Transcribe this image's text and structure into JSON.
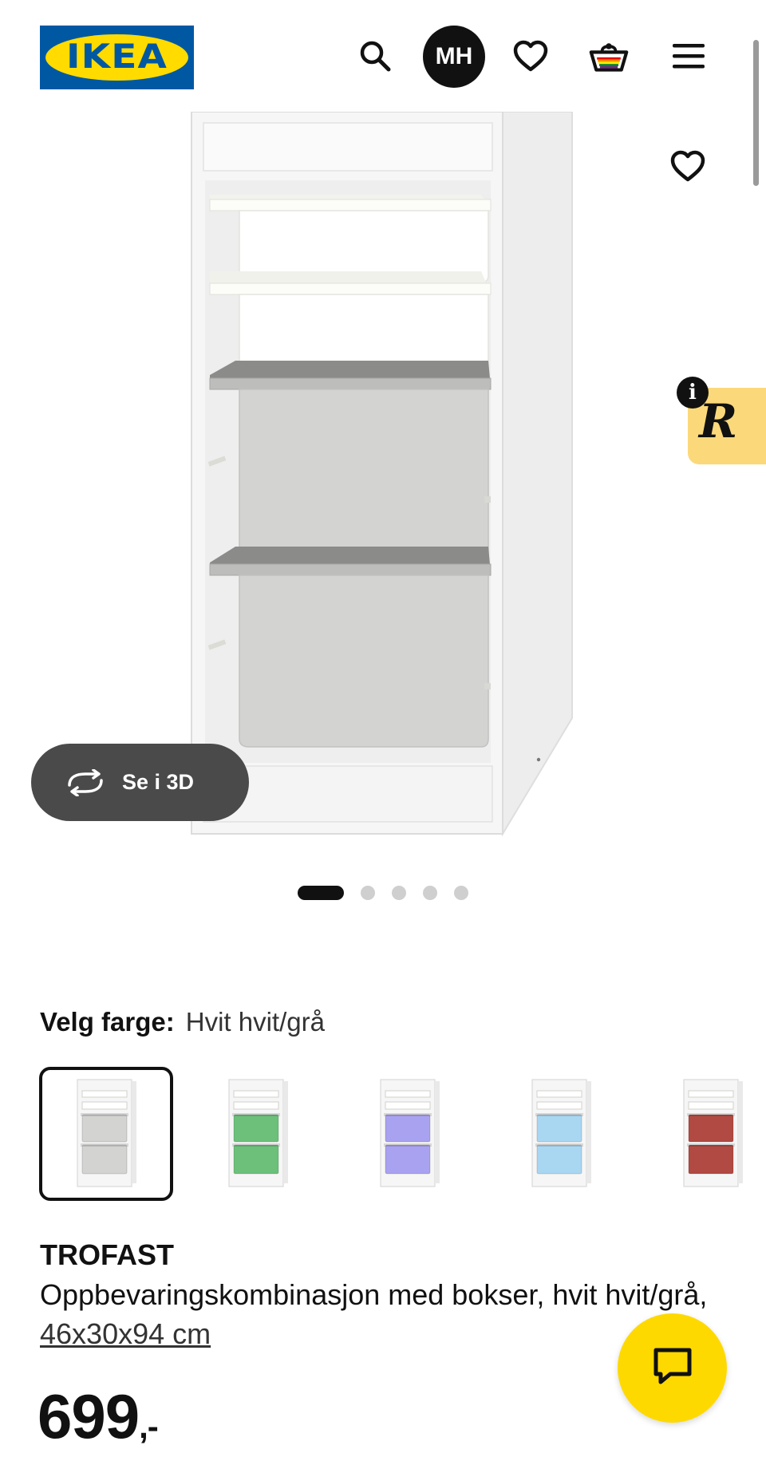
{
  "header": {
    "logo_text": "IKEA",
    "avatar_initials": "MH",
    "icons": [
      "search-icon",
      "favourites-icon",
      "cart-icon",
      "menu-icon"
    ]
  },
  "gallery": {
    "view_3d_label": "Se i 3D",
    "slide_count": 5,
    "active_slide": 1
  },
  "color_choice": {
    "label": "Velg farge:",
    "value": "Hvit hvit/grå",
    "options": [
      {
        "name": "hvit/grå",
        "box_color": "#d3d3d1",
        "selected": true
      },
      {
        "name": "grønn",
        "box_color": "#6cc07a",
        "selected": false
      },
      {
        "name": "lilla",
        "box_color": "#a9a2f0",
        "selected": false
      },
      {
        "name": "blå",
        "box_color": "#a9d7f2",
        "selected": false
      },
      {
        "name": "rød",
        "box_color": "#b14a42",
        "selected": false
      }
    ]
  },
  "product": {
    "name": "TROFAST",
    "description": "Oppbevaringskombinasjon med bokser, hvit hvit/grå,",
    "dimensions": "46x30x94 cm",
    "price": "699",
    "price_suffix": ",-"
  },
  "colors": {
    "ikea_blue": "#0058a3",
    "ikea_yellow": "#ffdb00",
    "chat_yellow": "#fed900",
    "badge_yellow": "#fbd97a",
    "pill_dark": "#4a4a4a"
  }
}
